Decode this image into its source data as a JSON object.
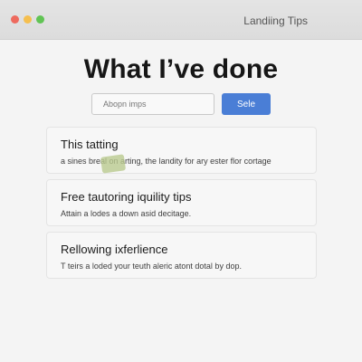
{
  "window": {
    "title": "Landiing Tips",
    "controls": {
      "close_color": "#ee6a5e",
      "minimize_color": "#f5bf4f",
      "maximize_color": "#61c454"
    }
  },
  "main": {
    "heading": "What I’ve done",
    "search": {
      "placeholder": "Abopn imps",
      "value": ""
    },
    "button": {
      "label": "Sele",
      "color": "#4a7ed6"
    },
    "cards": [
      {
        "title": "This tatting",
        "description": "a sines breal on arting, the landity for ary ester flor cortage"
      },
      {
        "title": "Free tautoring iquility tips",
        "description": "Attain a lodes a down asid decitage."
      },
      {
        "title": "Rellowing ixferlience",
        "description": "T teirs a loded your teuth aleric atont dotal by dop."
      }
    ]
  },
  "colors": {
    "background": "#f4f4f4",
    "accent": "#4a7ed6",
    "sticky_note": "#b9c98e"
  }
}
